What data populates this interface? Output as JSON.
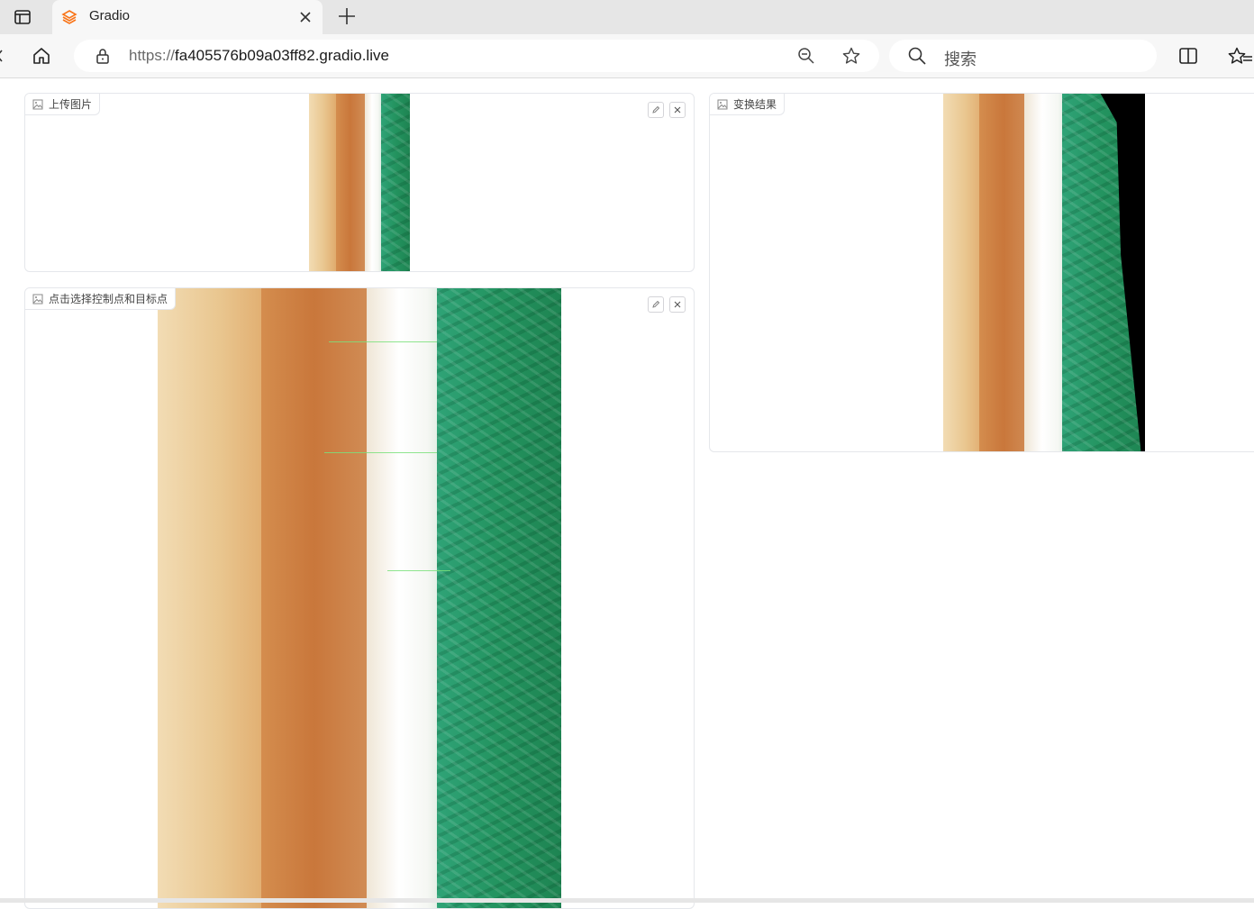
{
  "browser": {
    "tab_title": "Gradio",
    "url_scheme": "https://",
    "url_host": "fa405576b09a03ff82.gradio.live",
    "search_placeholder": "搜索"
  },
  "blocks": {
    "upload": {
      "label": "上传图片"
    },
    "select_points": {
      "label": "点击选择控制点和目标点"
    },
    "result": {
      "label": "变换结果"
    }
  },
  "icons": {
    "tab_actions": "sidebar-tabs-icon",
    "favicon": "gradio-logo-icon",
    "tab_close": "close-icon",
    "new_tab": "plus-icon",
    "home": "home-icon",
    "lock": "lock-icon",
    "zoom_out": "zoom-out-icon",
    "favorite": "star-icon",
    "search": "search-icon",
    "split_screen": "split-screen-icon",
    "favorites": "favorites-icon",
    "image": "image-icon",
    "edit": "pencil-icon",
    "clear": "close-icon"
  },
  "colors": {
    "accent_gradio": "#f97316",
    "control_line": "#7be07b"
  }
}
